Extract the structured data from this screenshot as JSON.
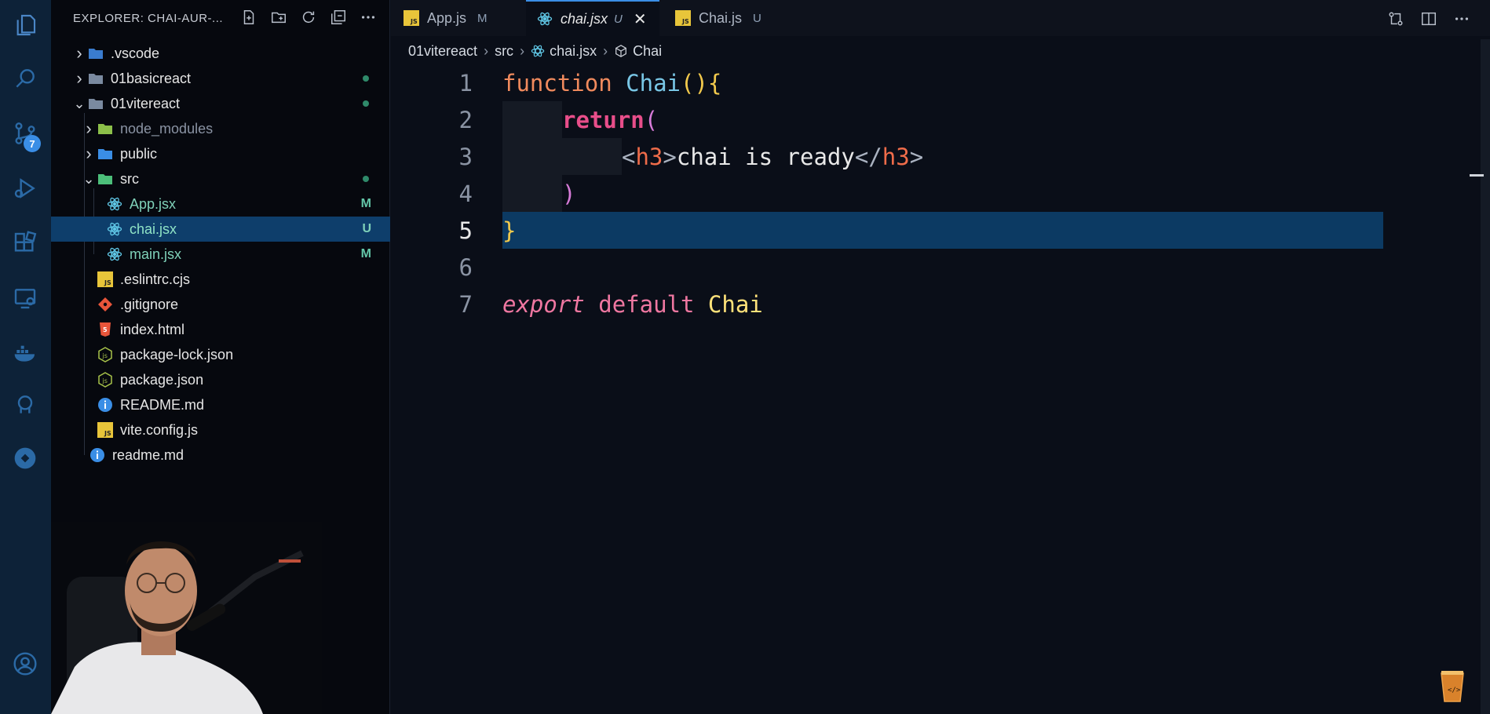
{
  "activity_bar": {
    "items": [
      "explorer-icon",
      "search-icon",
      "source-control-icon",
      "run-debug-icon",
      "extensions-icon",
      "remote-explorer-icon",
      "docker-icon",
      "github-icon",
      "deploy-icon",
      "account-icon"
    ],
    "source_control_badge": "7"
  },
  "sidebar": {
    "title": "EXPLORER: CHAI-AUR-...",
    "tree": [
      {
        "label": ".vscode",
        "kind": "folder",
        "expanded": false,
        "status": ""
      },
      {
        "label": "01basicreact",
        "kind": "folder",
        "expanded": false,
        "status": "dot"
      },
      {
        "label": "01vitereact",
        "kind": "folder",
        "expanded": true,
        "status": "dot"
      },
      {
        "label": "node_modules",
        "kind": "folder",
        "expanded": false,
        "status": ""
      },
      {
        "label": "public",
        "kind": "folder",
        "expanded": false,
        "status": ""
      },
      {
        "label": "src",
        "kind": "folder",
        "expanded": true,
        "status": "dot"
      },
      {
        "label": "App.jsx",
        "kind": "react",
        "status": "M"
      },
      {
        "label": "chai.jsx",
        "kind": "react",
        "status": "U",
        "selected": true
      },
      {
        "label": "main.jsx",
        "kind": "react",
        "status": "M"
      },
      {
        "label": ".eslintrc.cjs",
        "kind": "js",
        "status": ""
      },
      {
        "label": ".gitignore",
        "kind": "git",
        "status": ""
      },
      {
        "label": "index.html",
        "kind": "html",
        "status": ""
      },
      {
        "label": "package-lock.json",
        "kind": "json",
        "status": ""
      },
      {
        "label": "package.json",
        "kind": "json",
        "status": ""
      },
      {
        "label": "README.md",
        "kind": "info",
        "status": ""
      },
      {
        "label": "vite.config.js",
        "kind": "js",
        "status": ""
      },
      {
        "label": "readme.md",
        "kind": "info",
        "status": ""
      }
    ]
  },
  "tabs": [
    {
      "label": "App.js",
      "status": "M",
      "icon": "js-icon",
      "active": false
    },
    {
      "label": "chai.jsx",
      "status": "U",
      "icon": "react-icon",
      "active": true
    },
    {
      "label": "Chai.js",
      "status": "U",
      "icon": "js-icon",
      "active": false
    }
  ],
  "breadcrumb": [
    "01vitereact",
    "src",
    "chai.jsx",
    "Chai"
  ],
  "editor": {
    "line_numbers": [
      "1",
      "2",
      "3",
      "4",
      "5",
      "6",
      "7"
    ],
    "current_line": "5",
    "code": {
      "l1_kw": "function",
      "l1_name": "Chai",
      "l1_paren": "()",
      "l1_brace": "{",
      "l2_kw": "return",
      "l2_paren": "(",
      "l3_open_lt": "<",
      "l3_open_tag": "h3",
      "l3_open_gt": ">",
      "l3_text": "chai is ready",
      "l3_close_lt": "</",
      "l3_close_tag": "h3",
      "l3_close_gt": ">",
      "l4_paren": ")",
      "l5_brace": "}",
      "l7_export": "export",
      "l7_default": "default",
      "l7_name": "Chai"
    }
  },
  "colors": {
    "accent": "#3a8ee6",
    "modified": "#63c6a8",
    "untracked": "#7fd1b9",
    "selection": "#0e3e6b"
  }
}
